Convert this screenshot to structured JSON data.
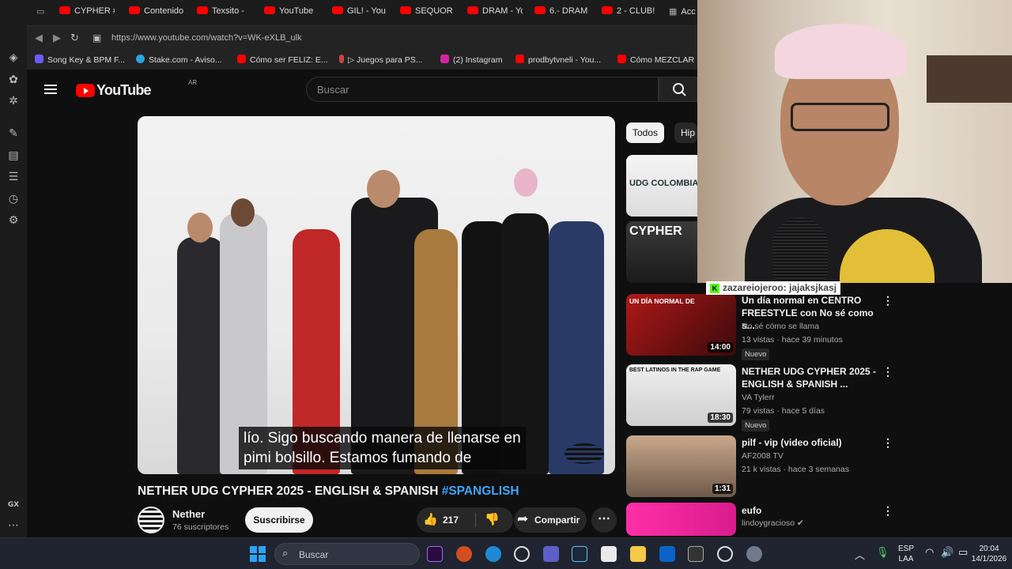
{
  "browser": {
    "tabs": [
      "CYPHER #",
      "Contenido",
      "Texsito -",
      "YouTube",
      "GIL! - You",
      "SEQUOR &",
      "DRAM - Yo",
      "6.- DRAM",
      "2 - CLUB!",
      "Acc"
    ],
    "url": "https://www.youtube.com/watch?v=WK-eXLB_ulk",
    "bookmarks": [
      "Song Key & BPM F...",
      "Stake.com - Aviso...",
      "Cómo ser FELIZ: E...",
      "▷ Juegos para PS...",
      "(2) Instagram",
      "prodbytvneli - You...",
      "Cómo MEZCLAR"
    ],
    "rail_label": "GX"
  },
  "youtube": {
    "logo_text": "YouTube",
    "country": "AR",
    "search_placeholder": "Buscar",
    "video": {
      "subtitle_line1": "lío. Sigo buscando manera de llenarse en",
      "subtitle_line2": "pimi bolsillo. Estamos fumando de",
      "title": "NETHER UDG CYPHER 2025 - ENGLISH & SPANISH",
      "hashtag": "#SPANGLISH",
      "channel": "Nether",
      "subscribers": "76 suscriptores",
      "subscribe_label": "Suscribirse",
      "likes": "217",
      "share_label": "Compartir"
    },
    "chips": [
      "Todos",
      "Hip"
    ],
    "related": [
      {
        "thumb_text": "UDG COLOMBIA CYP"
      },
      {
        "thumb_text": "CYPHER"
      },
      {
        "title": "Un día normal en CENTRO FREESTYLE con No sé como s...",
        "channel": "No sé cómo se llama",
        "meta": "13 vistas · hace 39 minutos",
        "duration": "14:00",
        "badge": "Nuevo",
        "thumb_text": "UN DÍA NORMAL DE"
      },
      {
        "title": "NETHER UDG CYPHER 2025 - ENGLISH & SPANISH ...",
        "channel": "VA Tylerr",
        "meta": "79 vistas · hace 5 días",
        "duration": "18:30",
        "badge": "Nuevo",
        "thumb_text": "BEST LATINOS IN THE RAP GAME"
      },
      {
        "title": "pilf - vip (video oficial)",
        "channel": "AF2008 TV",
        "meta": "21 k vistas · hace 3 semanas",
        "duration": "1:31"
      },
      {
        "title": "eufo",
        "channel": "lindoygracioso"
      }
    ]
  },
  "stream": {
    "chat_user": "zazareiojeroo",
    "chat_message": ": jajaksjkasj"
  },
  "taskbar": {
    "search_placeholder": "Buscar",
    "lang": "ESP",
    "layout": "LAA",
    "time": "20:04",
    "date": "14/1/2026"
  },
  "colors": {
    "youtube_red": "#ff0000",
    "link_blue": "#3ea6ff",
    "kick_green": "#53fc18"
  }
}
